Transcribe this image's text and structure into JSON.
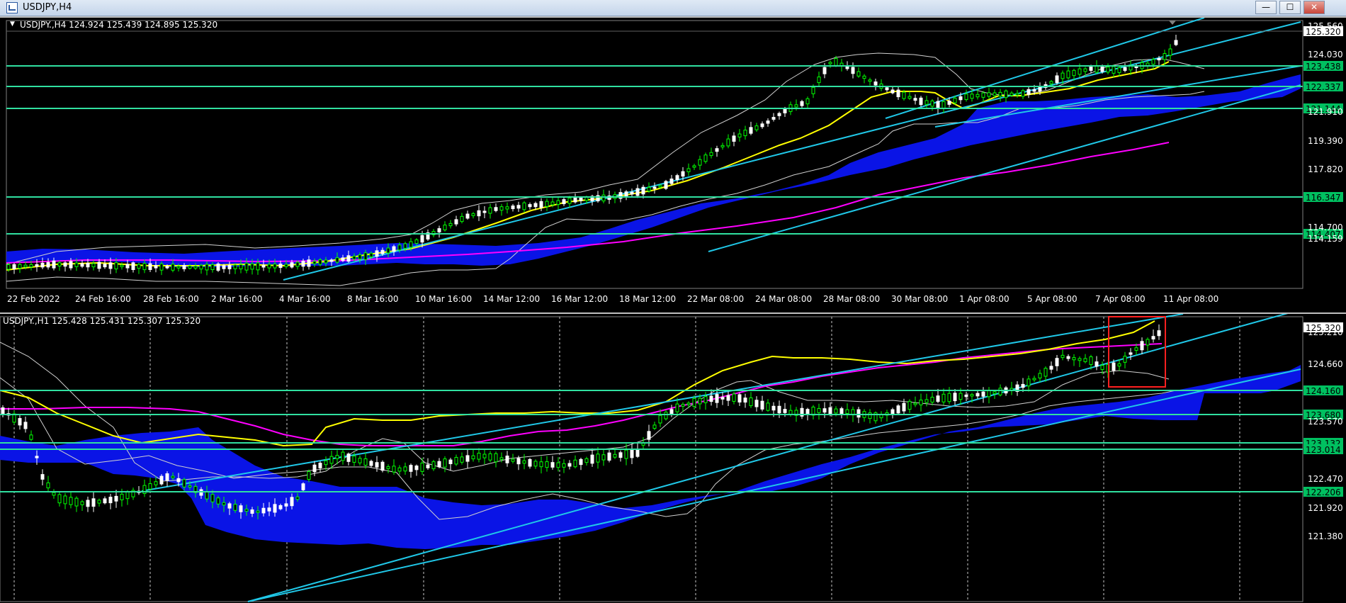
{
  "window": {
    "title": "USDJPY,H4",
    "minimize": "—",
    "maximize": "☐",
    "close": "✕"
  },
  "pane1": {
    "info": "USDJPY.,H4  124.924 125.439 124.895 125.320",
    "price_scale": [
      "125.560",
      "124.030",
      "121.910",
      "119.390",
      "117.820",
      "114.700",
      "114.159"
    ],
    "hlines": [
      "123.438",
      "122.337",
      "121.144",
      "116.347",
      "114.407"
    ],
    "current_price": "125.320",
    "time_labels": [
      "22 Feb 2022",
      "24 Feb 16:00",
      "28 Feb 16:00",
      "2 Mar 16:00",
      "4 Mar 16:00",
      "8 Mar 16:00",
      "10 Mar 16:00",
      "14 Mar 12:00",
      "16 Mar 12:00",
      "18 Mar 12:00",
      "22 Mar 08:00",
      "24 Mar 08:00",
      "28 Mar 08:00",
      "30 Mar 08:00",
      "1 Apr 08:00",
      "5 Apr 08:00",
      "7 Apr 08:00",
      "11 Apr 08:00"
    ]
  },
  "pane2": {
    "info": "USDJPY.,H1  125.428 125.431 125.307 125.320",
    "price_scale": [
      "125.210",
      "124.660",
      "123.570",
      "122.470",
      "121.920",
      "121.380"
    ],
    "hlines": [
      "124.160",
      "123.680",
      "123.132",
      "123.014",
      "122.206"
    ],
    "current_price": "125.320"
  },
  "colors": {
    "background": "#000000",
    "bull": "#00ff00",
    "bear": "#ffffff",
    "hline": "#30e0a0",
    "channel": "#20c8e8",
    "ma_fast": "#ffff00",
    "ma_slow": "#ff00ff",
    "bands": "#d0d0d0",
    "cloud": "#0a14e6",
    "highlight_box": "#ff2020",
    "price_label_bg": "#00c060"
  }
}
